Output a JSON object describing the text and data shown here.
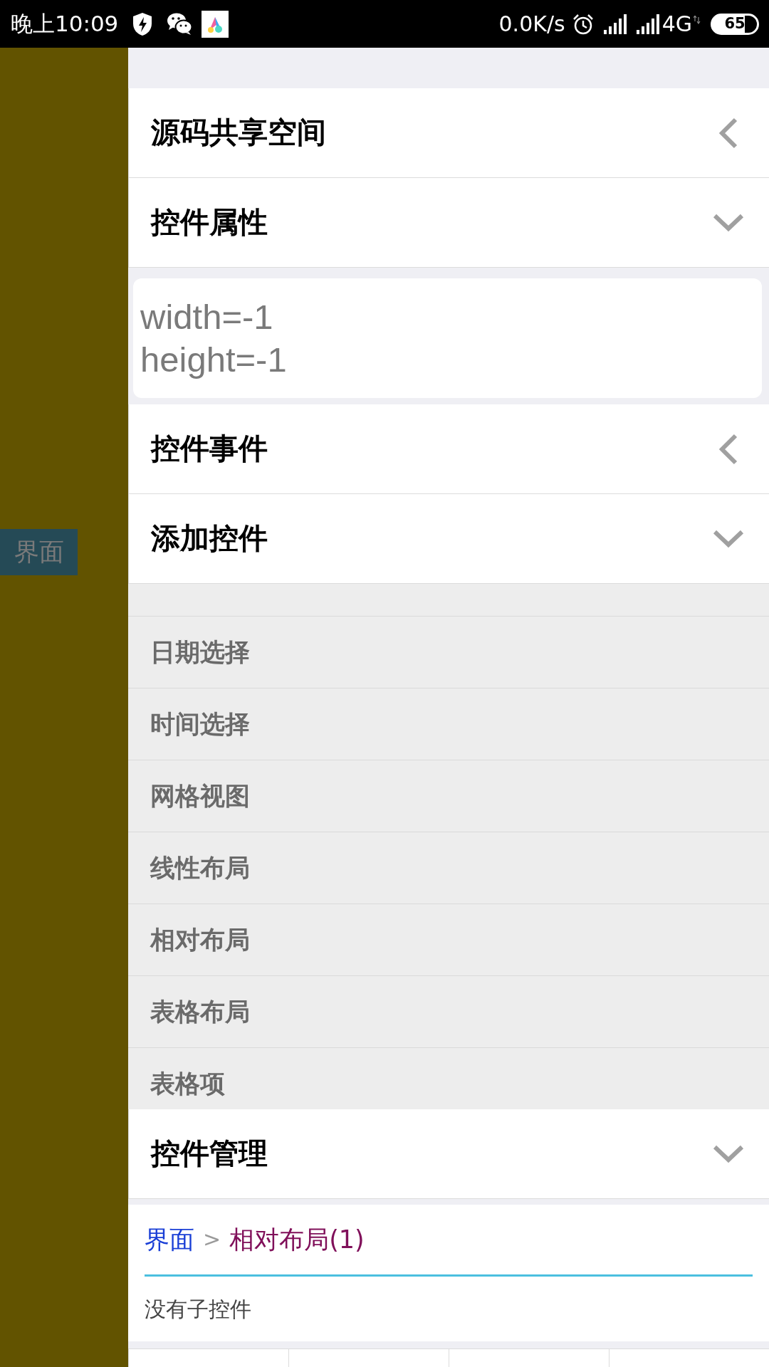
{
  "status_bar": {
    "time": "晚上10:09",
    "net_speed": "0.0K/s",
    "network": "4G",
    "battery": "65"
  },
  "side_tab": {
    "label": "界面"
  },
  "sections": [
    {
      "title": "源码共享空间",
      "expanded": false
    },
    {
      "title": "控件属性",
      "expanded": true,
      "body": {
        "kind": "properties",
        "lines": [
          "width=-1",
          "height=-1"
        ]
      }
    },
    {
      "title": "控件事件",
      "expanded": false
    },
    {
      "title": "添加控件",
      "expanded": true,
      "body": {
        "kind": "list",
        "items": [
          "日期选择",
          "时间选择",
          "网格视图",
          "线性布局",
          "相对布局",
          "表格布局",
          "表格项"
        ]
      }
    },
    {
      "title": "控件管理",
      "expanded": true,
      "body": {
        "kind": "manager",
        "breadcrumb": [
          {
            "label": "界面",
            "color": "#1a3fd6"
          },
          {
            "label": "相对布局(1)",
            "color": "#80105a"
          }
        ],
        "separator": ">",
        "message": "没有子控件"
      }
    }
  ]
}
